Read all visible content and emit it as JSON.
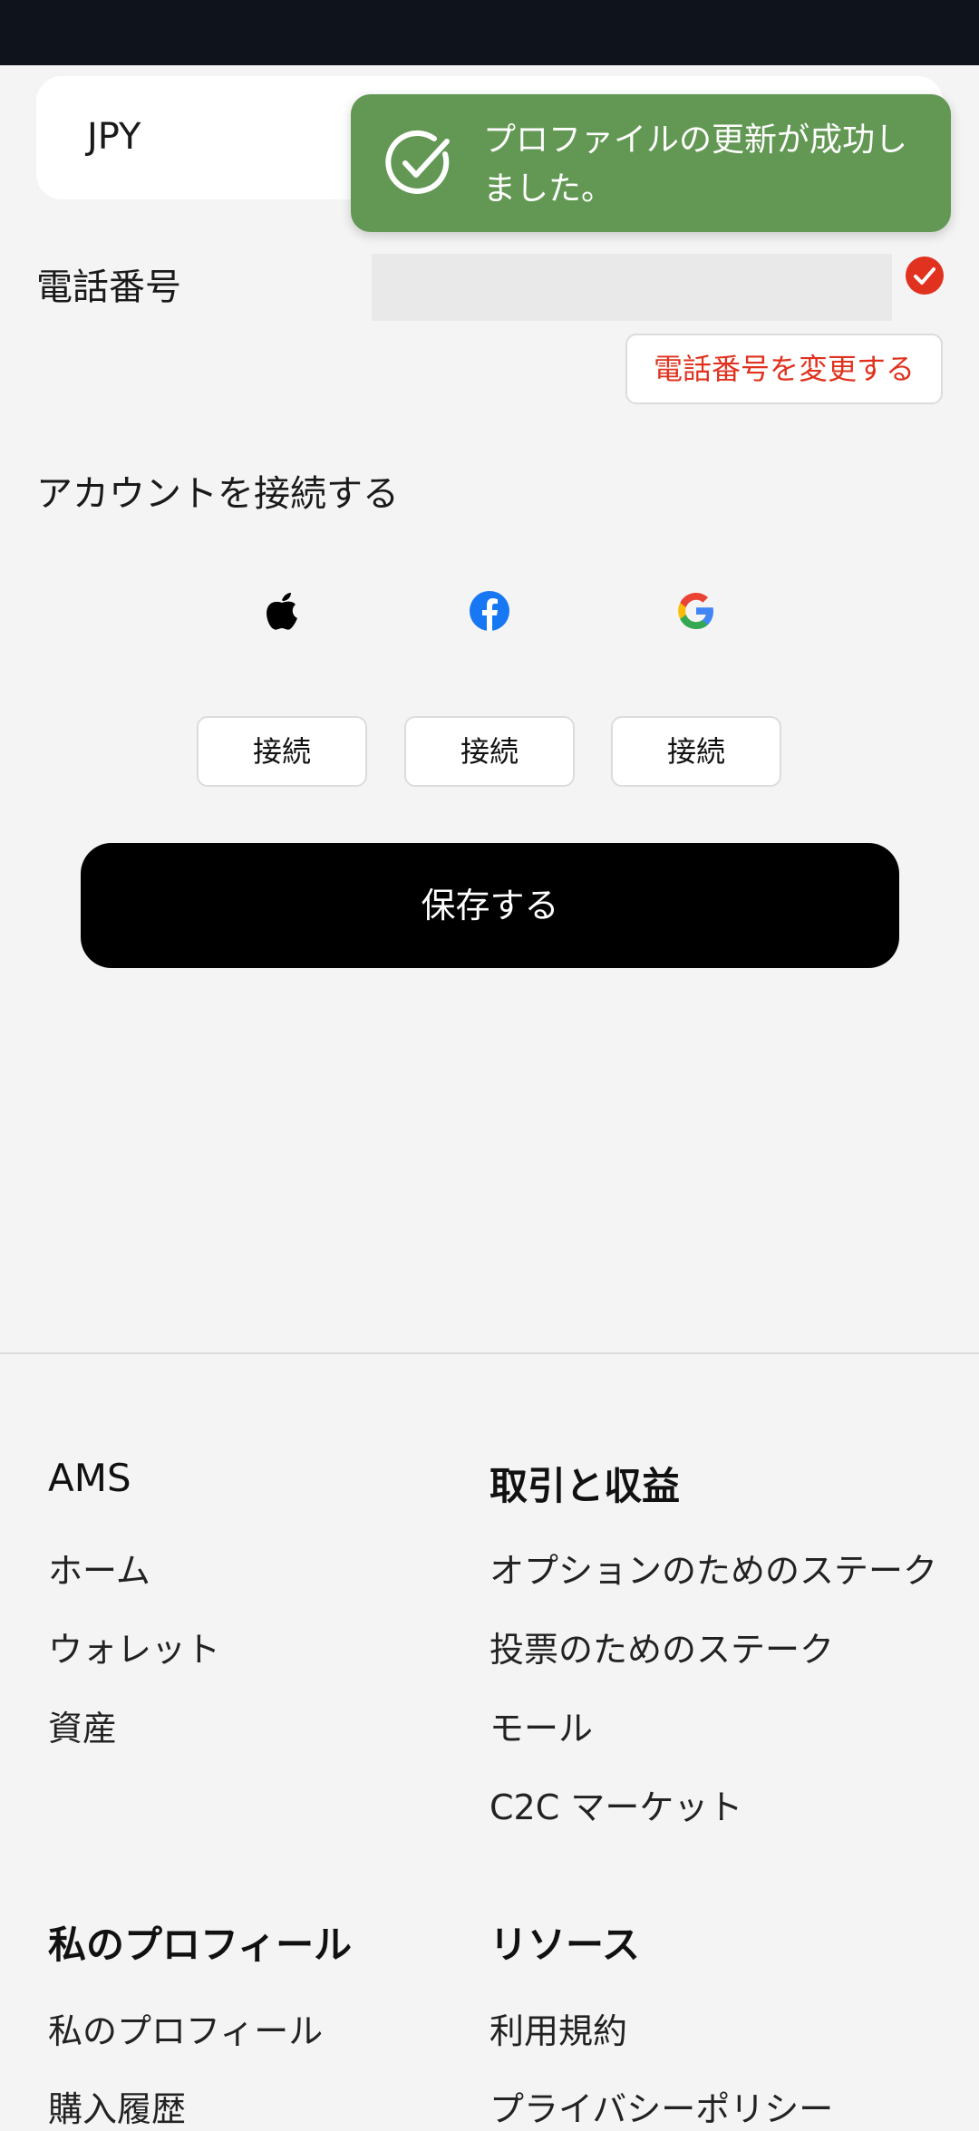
{
  "currency": {
    "value": "JPY"
  },
  "toast": {
    "message": "プロファイルの更新が成功しました。"
  },
  "phone": {
    "label": "電話番号",
    "value": "",
    "change_button": "電話番号を変更する"
  },
  "connect": {
    "title": "アカウントを接続する",
    "providers": [
      {
        "icon": "apple-icon",
        "button": "接続"
      },
      {
        "icon": "facebook-icon",
        "button": "接続"
      },
      {
        "icon": "google-icon",
        "button": "接続"
      }
    ]
  },
  "save_button": "保存する",
  "footer": {
    "sections": [
      {
        "heading": "AMS",
        "links": [
          "ホーム",
          "ウォレット",
          "資産"
        ]
      },
      {
        "heading": "取引と収益",
        "links": [
          "オプションのためのステーク",
          "投票のためのステーク",
          "モール",
          "C2C マーケット"
        ]
      },
      {
        "heading": "私のプロフィール",
        "links": [
          "私のプロフィール",
          "購入履歴"
        ]
      },
      {
        "heading": "リソース",
        "links": [
          "利用規約",
          "プライバシーポリシー"
        ]
      }
    ]
  },
  "colors": {
    "toast_bg": "#629853",
    "accent_red": "#e0321e",
    "save_bg": "#000000",
    "facebook_blue": "#1877f2"
  }
}
